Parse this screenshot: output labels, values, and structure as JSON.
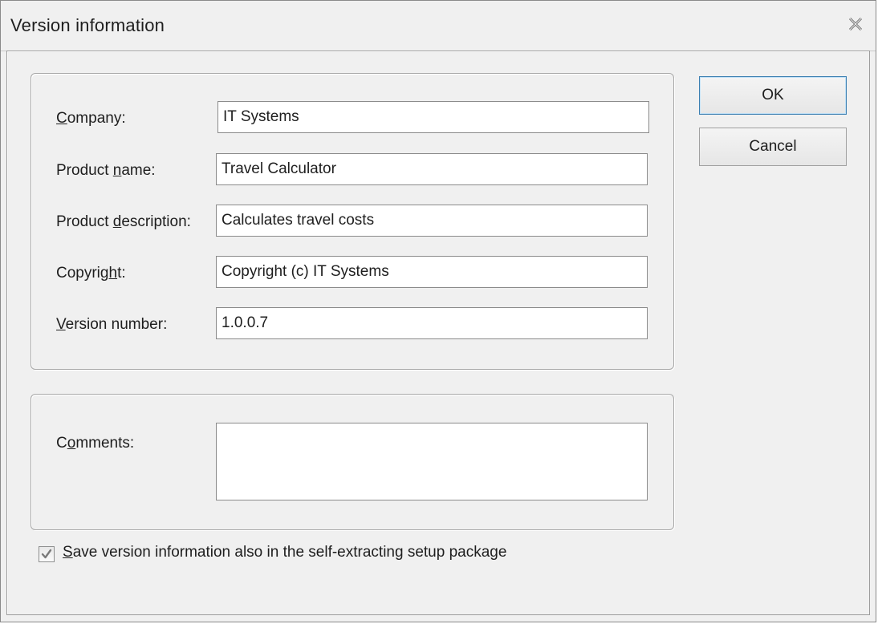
{
  "window": {
    "title": "Version information",
    "close_icon": "close-icon"
  },
  "form": {
    "company": {
      "label_key": "C",
      "label_rest": "ompany:",
      "value": "IT Systems"
    },
    "product_name": {
      "label_pre": "Product ",
      "label_key": "n",
      "label_rest": "ame:",
      "value": "Travel Calculator"
    },
    "product_description": {
      "label_pre": "Product ",
      "label_key": "d",
      "label_rest": "escription:",
      "value": "Calculates travel costs"
    },
    "copyright": {
      "label_pre": "Copyrig",
      "label_key": "h",
      "label_rest": "t:",
      "value": "Copyright (c) IT Systems"
    },
    "version_number": {
      "label_key": "V",
      "label_rest": "ersion number:",
      "value": "1.0.0.7"
    },
    "comments": {
      "label_pre": "C",
      "label_key": "o",
      "label_rest": "mments:",
      "value": ""
    }
  },
  "buttons": {
    "ok_label": "OK",
    "cancel_label": "Cancel"
  },
  "options": {
    "save_in_setup": {
      "checked": true,
      "label_key": "S",
      "label_rest": "ave version information also in the self-extracting setup package"
    }
  },
  "colors": {
    "dialog_bg": "#f0f0f0",
    "default_button_border": "#3c7fb1"
  }
}
